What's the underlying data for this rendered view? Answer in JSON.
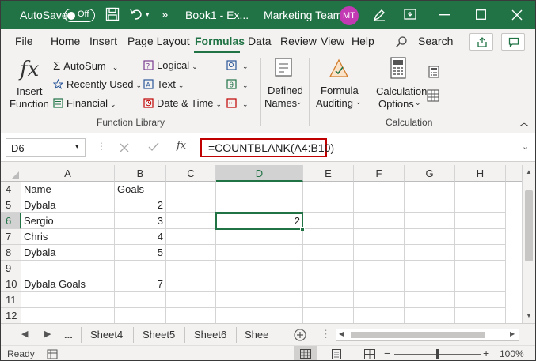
{
  "titlebar": {
    "autosave_label": "AutoSave",
    "autosave_state": "Off",
    "doc_title": "Book1 - Ex...",
    "team": "Marketing Team",
    "avatar_initials": "MT",
    "more_label": "»"
  },
  "tabs": [
    "File",
    "Home",
    "Insert",
    "Page Layout",
    "Formulas",
    "Data",
    "Review",
    "View",
    "Help"
  ],
  "active_tab": "Formulas",
  "search_label": "Search",
  "ribbon": {
    "function_library": {
      "insert_function_line1": "Insert",
      "insert_function_line2": "Function",
      "autosum": "AutoSum",
      "recently_used": "Recently Used",
      "financial": "Financial",
      "logical": "Logical",
      "text": "Text",
      "date_time": "Date & Time",
      "label": "Function Library"
    },
    "defined_names_line1": "Defined",
    "defined_names_line2": "Names",
    "formula_auditing_line1": "Formula",
    "formula_auditing_line2": "Auditing",
    "calculation_options_line1": "Calculation",
    "calculation_options_line2": "Options",
    "calculation_label": "Calculation"
  },
  "formula_bar": {
    "name_box": "D6",
    "formula": "=COUNTBLANK(A4:B10)",
    "fx_label": "fx"
  },
  "columns": [
    "A",
    "B",
    "C",
    "D",
    "E",
    "F",
    "G",
    "H"
  ],
  "selected_column": "D",
  "rows": [
    {
      "n": "4",
      "A": "Name",
      "B": "Goals",
      "D": ""
    },
    {
      "n": "5",
      "A": "Dybala",
      "B": "2",
      "D": ""
    },
    {
      "n": "6",
      "A": "Sergio",
      "B": "3",
      "D": "2"
    },
    {
      "n": "7",
      "A": "Chris",
      "B": "4",
      "D": ""
    },
    {
      "n": "8",
      "A": "Dybala",
      "B": "5",
      "D": ""
    },
    {
      "n": "9",
      "A": "",
      "B": "",
      "D": ""
    },
    {
      "n": "10",
      "A": "Dybala Goals",
      "B": "7",
      "D": ""
    },
    {
      "n": "11",
      "A": "",
      "B": "",
      "D": ""
    },
    {
      "n": "12",
      "A": "",
      "B": "",
      "D": ""
    }
  ],
  "selected_row": "6",
  "sheets": {
    "ellipsis": "...",
    "tabs": [
      "Sheet4",
      "Sheet5",
      "Sheet6",
      "Shee"
    ]
  },
  "statusbar": {
    "ready": "Ready",
    "zoom_minus": "−",
    "zoom_plus": "+",
    "zoom": "100%"
  },
  "colors": {
    "brand": "#217346",
    "highlight_border": "#c00000",
    "avatar": "#c239b3"
  }
}
